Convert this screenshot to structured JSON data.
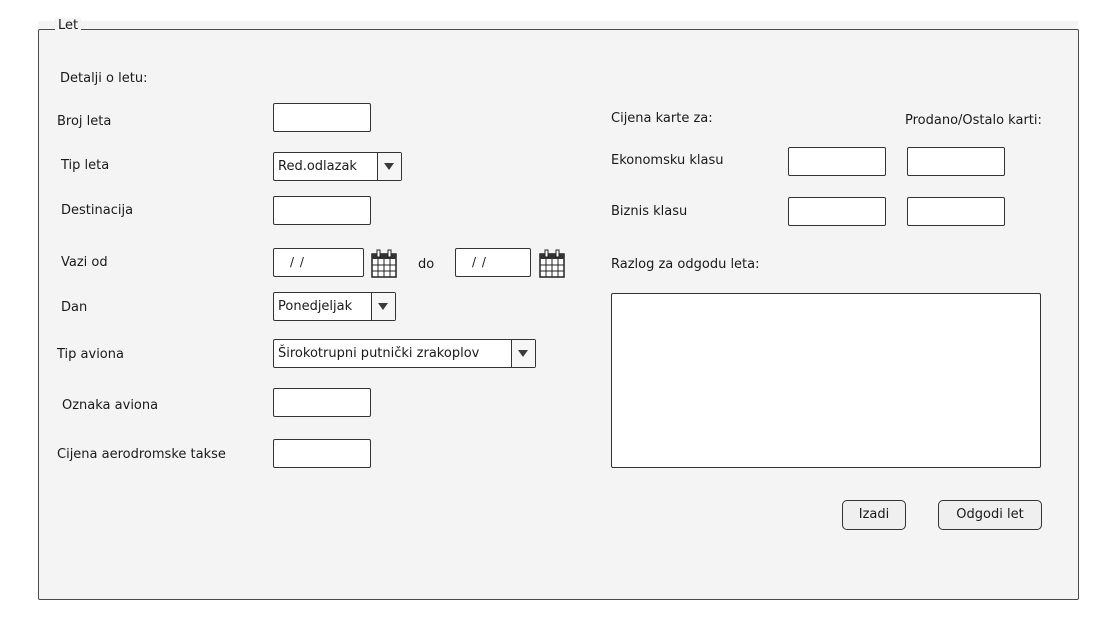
{
  "fieldset": {
    "legend": "Let"
  },
  "left": {
    "section_title": "Detalji o letu:",
    "broj_leta_label": "Broj leta",
    "tip_leta_label": "Tip leta",
    "tip_leta_value": "Red.odlazak",
    "destinacija_label": "Destinacija",
    "vazi_od_label": "Vazi od",
    "date_from_value": "/ /",
    "do_label": "do",
    "date_to_value": "/ /",
    "dan_label": "Dan",
    "dan_value": "Ponedjeljak",
    "tip_aviona_label": "Tip aviona",
    "tip_aviona_value": "Širokotrupni putnički zrakoplov",
    "oznaka_aviona_label": "Oznaka aviona",
    "cijena_takse_label": "Cijena aerodromske takse"
  },
  "right": {
    "cijena_karte_label": "Cijena karte za:",
    "prodano_label": "Prodano/Ostalo karti:",
    "ekonomska_label": "Ekonomsku klasu",
    "biznis_label": "Biznis klasu",
    "razlog_label": "Razlog za odgodu leta:"
  },
  "buttons": {
    "izadi": "Izadi",
    "odgodi": "Odgodi let"
  }
}
